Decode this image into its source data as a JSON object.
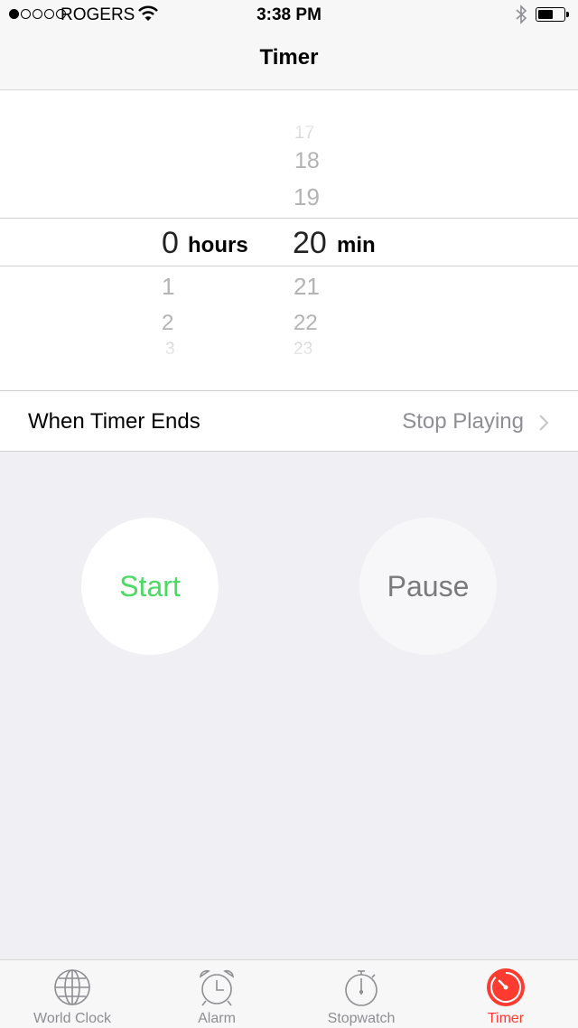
{
  "status_bar": {
    "signal_strength": 1,
    "signal_max": 5,
    "carrier": "ROGERS",
    "time": "3:38 PM",
    "battery_percent": 60
  },
  "nav": {
    "title": "Timer"
  },
  "picker": {
    "hours_above": [],
    "hours_selected": "0",
    "hours_unit": "hours",
    "hours_below": [
      "1",
      "2",
      "3"
    ],
    "minutes_above": [
      "17",
      "18",
      "19"
    ],
    "minutes_selected": "20",
    "minutes_unit": "min",
    "minutes_below": [
      "21",
      "22",
      "23"
    ]
  },
  "when_timer_ends": {
    "label": "When Timer Ends",
    "value": "Stop Playing"
  },
  "buttons": {
    "start": "Start",
    "pause": "Pause"
  },
  "colors": {
    "start_green": "#4cd964",
    "accent_red": "#ff3b30",
    "inactive_gray": "#8e8e93"
  },
  "tabs": [
    {
      "label": "World Clock",
      "icon": "globe-icon",
      "active": false
    },
    {
      "label": "Alarm",
      "icon": "alarm-clock-icon",
      "active": false
    },
    {
      "label": "Stopwatch",
      "icon": "stopwatch-icon",
      "active": false
    },
    {
      "label": "Timer",
      "icon": "timer-icon",
      "active": true
    }
  ]
}
